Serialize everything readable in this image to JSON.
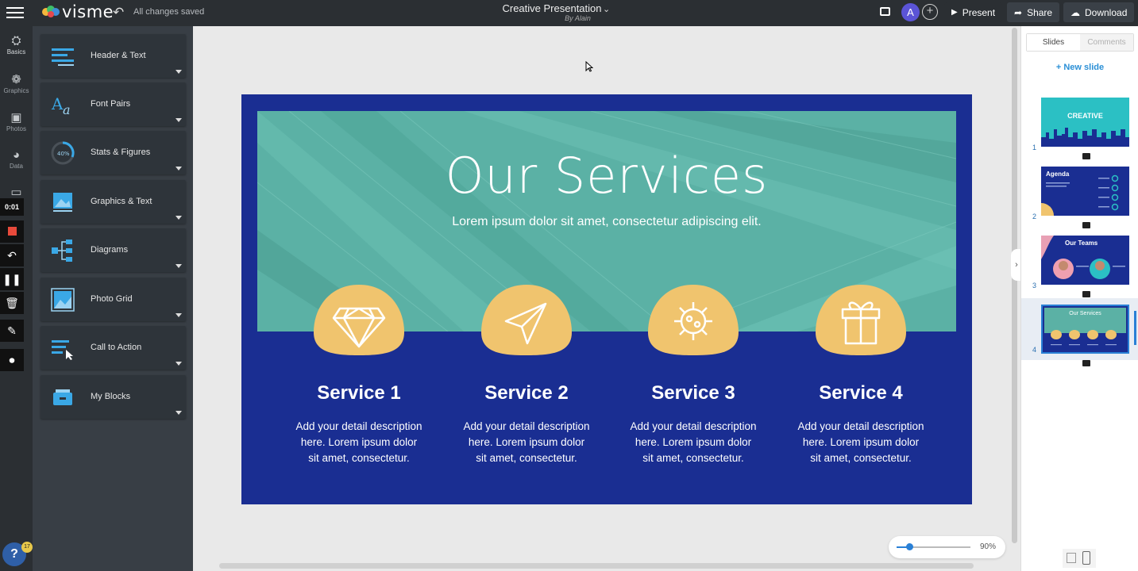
{
  "app": {
    "name": "visme",
    "save_status": "All changes saved"
  },
  "document": {
    "title": "Creative Presentation",
    "author": "By Alain"
  },
  "topbar": {
    "present_label": "Present",
    "share_label": "Share",
    "download_label": "Download",
    "avatar_initial": "A",
    "add_user_symbol": "+"
  },
  "rail": {
    "items": [
      {
        "label": "Basics",
        "icon": "basics-icon"
      },
      {
        "label": "Graphics",
        "icon": "graphics-icon"
      },
      {
        "label": "Photos",
        "icon": "photos-icon"
      },
      {
        "label": "Data",
        "icon": "data-icon"
      }
    ],
    "recording_time": "0:01"
  },
  "panel": {
    "blocks": [
      {
        "label": "Header & Text",
        "icon": "header-text-icon"
      },
      {
        "label": "Font Pairs",
        "icon": "font-pairs-icon"
      },
      {
        "label": "Stats & Figures",
        "icon": "stats-figures-icon"
      },
      {
        "label": "Graphics & Text",
        "icon": "graphics-text-icon"
      },
      {
        "label": "Diagrams",
        "icon": "diagrams-icon"
      },
      {
        "label": "Photo Grid",
        "icon": "photo-grid-icon"
      },
      {
        "label": "Call to Action",
        "icon": "call-to-action-icon"
      },
      {
        "label": "My Blocks",
        "icon": "my-blocks-icon"
      }
    ]
  },
  "slide": {
    "title": "Our Services",
    "subtitle": "Lorem ipsum dolor sit amet, consectetur adipiscing elit.",
    "services": [
      {
        "name": "Service 1",
        "icon": "diamond-icon",
        "description": "Add your detail description here. Lorem ipsum dolor sit amet, consectetur."
      },
      {
        "name": "Service 2",
        "icon": "paper-plane-icon",
        "description": "Add your detail description here. Lorem ipsum dolor sit amet, consectetur."
      },
      {
        "name": "Service 3",
        "icon": "virus-icon",
        "description": "Add your detail description here. Lorem ipsum dolor sit amet, consectetur."
      },
      {
        "name": "Service 4",
        "icon": "gift-icon",
        "description": "Add your detail description here. Lorem ipsum dolor sit amet, consectetur."
      }
    ],
    "colors": {
      "background": "#1a2e92",
      "hero": "#5bb1a5",
      "accent": "#f0c46e"
    }
  },
  "zoom": {
    "value": "90%",
    "level": 0.17
  },
  "right_panel": {
    "tabs": [
      "Slides",
      "Comments"
    ],
    "active_tab": "Slides",
    "new_slide_label": "+ New slide",
    "thumbnails": [
      {
        "number": "1",
        "title": "CREATIVE"
      },
      {
        "number": "2",
        "title": "Agenda"
      },
      {
        "number": "3",
        "title": "Our Teams"
      },
      {
        "number": "4",
        "title": "Our Services"
      }
    ],
    "active_slide": "4"
  },
  "help": {
    "symbol": "?",
    "badge": "17"
  }
}
